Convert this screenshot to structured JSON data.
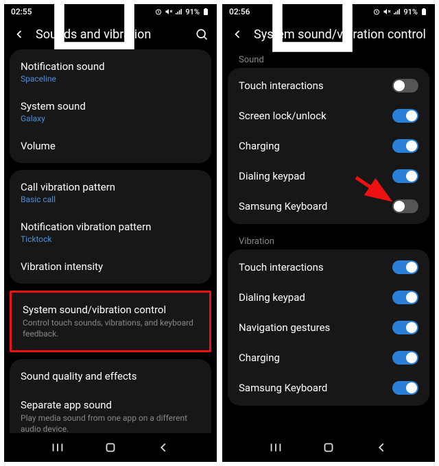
{
  "left": {
    "status": {
      "time": "02:55",
      "battery": "91%"
    },
    "header": {
      "title": "Sounds and vibration"
    },
    "card1": {
      "notification_sound": {
        "label": "Notification sound",
        "sub": "Spaceline"
      },
      "system_sound": {
        "label": "System sound",
        "sub": "Galaxy"
      },
      "volume": {
        "label": "Volume"
      }
    },
    "card2": {
      "call_vib": {
        "label": "Call vibration pattern",
        "sub": "Basic call"
      },
      "notif_vib": {
        "label": "Notification vibration pattern",
        "sub": "Ticktock"
      },
      "vib_intensity": {
        "label": "Vibration intensity"
      }
    },
    "card3": {
      "svc": {
        "label": "System sound/vibration control",
        "desc": "Control touch sounds, vibrations, and keyboard feedback."
      }
    },
    "card4": {
      "quality": {
        "label": "Sound quality and effects"
      },
      "separate": {
        "label": "Separate app sound",
        "desc": "Play media sound from one app on a different audio device."
      }
    }
  },
  "right": {
    "status": {
      "time": "02:56",
      "battery": "91%"
    },
    "header": {
      "title": "System sound/vibration control"
    },
    "section_sound": "Sound",
    "sound_rows": {
      "touch": "Touch interactions",
      "lock": "Screen lock/unlock",
      "charging": "Charging",
      "dialing": "Dialing keypad",
      "keyboard": "Samsung Keyboard"
    },
    "section_vibration": "Vibration",
    "vib_rows": {
      "touch": "Touch interactions",
      "dialing": "Dialing keypad",
      "nav": "Navigation gestures",
      "charging": "Charging",
      "keyboard": "Samsung Keyboard"
    },
    "toggles": {
      "sound_touch": false,
      "sound_lock": true,
      "sound_charging": true,
      "sound_dialing": true,
      "sound_keyboard": false,
      "vib_touch": true,
      "vib_dialing": true,
      "vib_nav": true,
      "vib_charging": true,
      "vib_keyboard": true
    }
  }
}
